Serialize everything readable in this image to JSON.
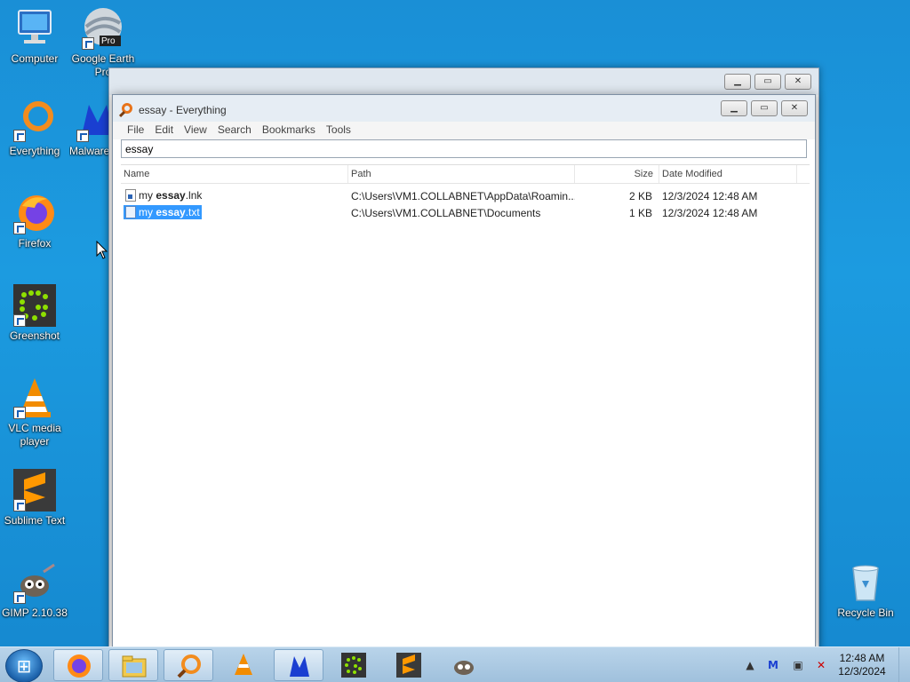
{
  "desktop": {
    "icons": [
      {
        "label": "Computer",
        "icon": "computer-icon"
      },
      {
        "label": "Google Earth Pro",
        "icon": "google-earth-icon"
      },
      {
        "label": "Everything",
        "icon": "everything-icon"
      },
      {
        "label": "Malwarebytes",
        "icon": "malwarebytes-icon"
      },
      {
        "label": "Firefox",
        "icon": "firefox-icon"
      },
      {
        "label": "Greenshot",
        "icon": "greenshot-icon"
      },
      {
        "label": "VLC media player",
        "icon": "vlc-icon"
      },
      {
        "label": "Sublime Text",
        "icon": "sublime-icon"
      },
      {
        "label": "GIMP 2.10.38",
        "icon": "gimp-icon"
      },
      {
        "label": "Recycle Bin",
        "icon": "recycle-bin-icon"
      }
    ],
    "earth_badge": "Pro"
  },
  "window": {
    "title": "essay - Everything",
    "menu": [
      "File",
      "Edit",
      "View",
      "Search",
      "Bookmarks",
      "Tools"
    ],
    "search_value": "essay",
    "columns": {
      "name": "Name",
      "path": "Path",
      "size": "Size",
      "date": "Date Modified"
    },
    "rows": [
      {
        "name_prefix": "my ",
        "name_match": "essay",
        "name_suffix": ".lnk",
        "path": "C:\\Users\\VM1.COLLABNET\\AppData\\Roamin...",
        "size": "2 KB",
        "date": "12/3/2024 12:48 AM",
        "selected": false,
        "icon": "shortcut-file-icon"
      },
      {
        "name_prefix": "my ",
        "name_match": "essay",
        "name_suffix": ".txt",
        "path": "C:\\Users\\VM1.COLLABNET\\Documents",
        "size": "1 KB",
        "date": "12/3/2024 12:48 AM",
        "selected": true,
        "icon": "text-file-icon"
      }
    ]
  },
  "taskbar": {
    "clock_time": "12:48 AM",
    "clock_date": "12/3/2024",
    "colors": {
      "accent": "#3399ff",
      "desktop": "#1a8fd6"
    }
  }
}
